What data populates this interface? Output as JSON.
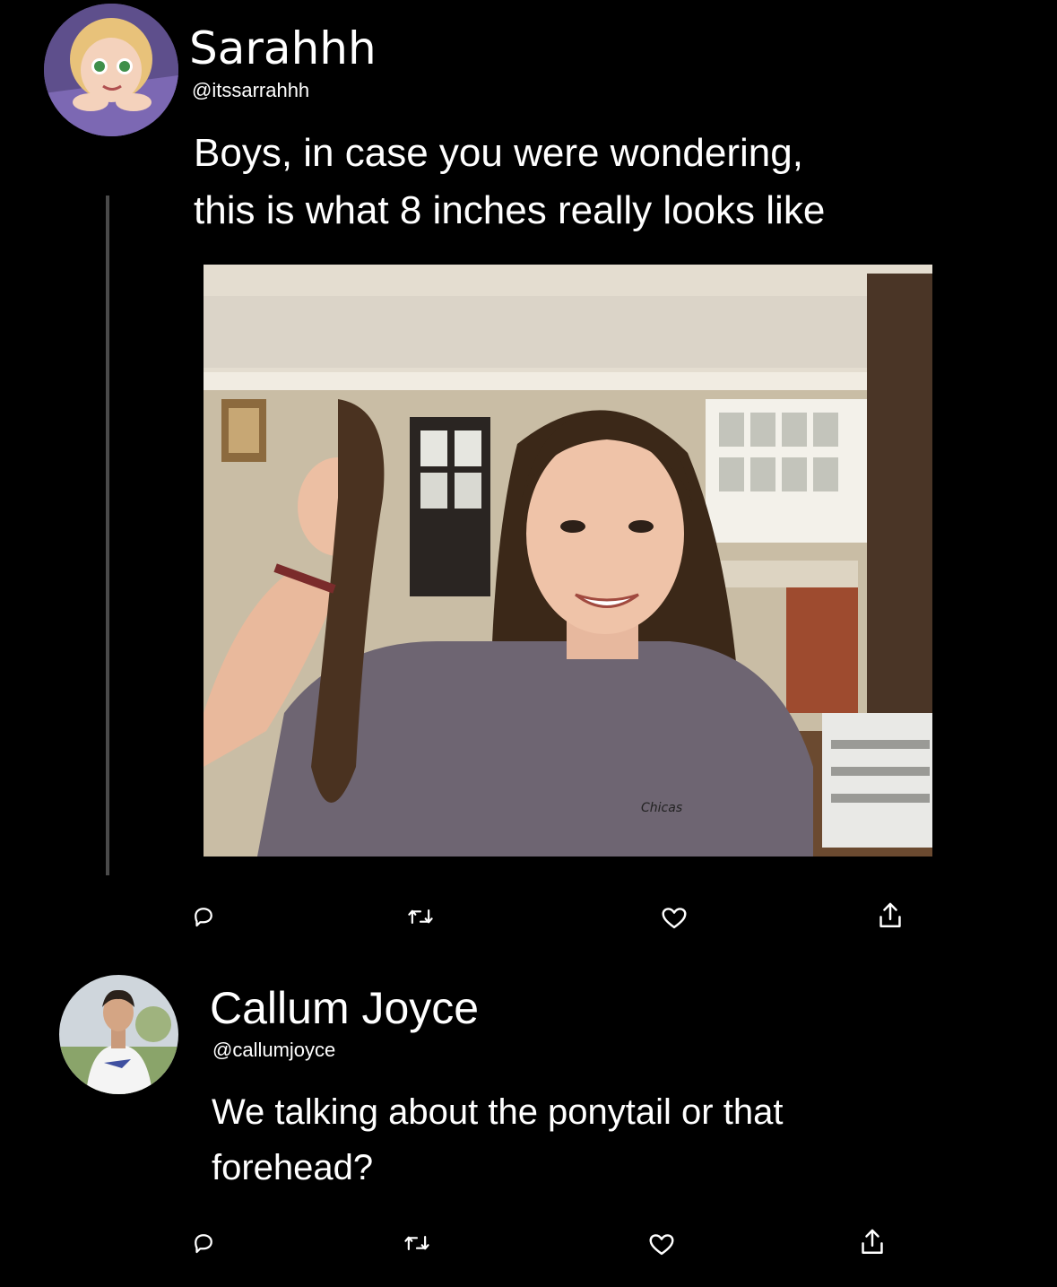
{
  "tweet": {
    "author_name": "Sarahhh",
    "author_handle": "@itssarrahhh",
    "text_line1": "Boys, in case you were wondering,",
    "text_line2": "this is what 8 inches really looks like",
    "photo_shirt_text": "Chicas",
    "actions": [
      "reply-icon",
      "retweet-icon",
      "like-icon",
      "share-icon"
    ]
  },
  "reply": {
    "author_name": "Callum Joyce",
    "author_handle": "@callumjoyce",
    "text_line1": "We talking about the ponytail or that",
    "text_line2": "forehead?",
    "actions": [
      "reply-icon",
      "retweet-icon",
      "like-icon",
      "share-icon"
    ]
  },
  "colors": {
    "background": "#000000",
    "text": "#ffffff",
    "thread_line": "#4a4a4a"
  }
}
